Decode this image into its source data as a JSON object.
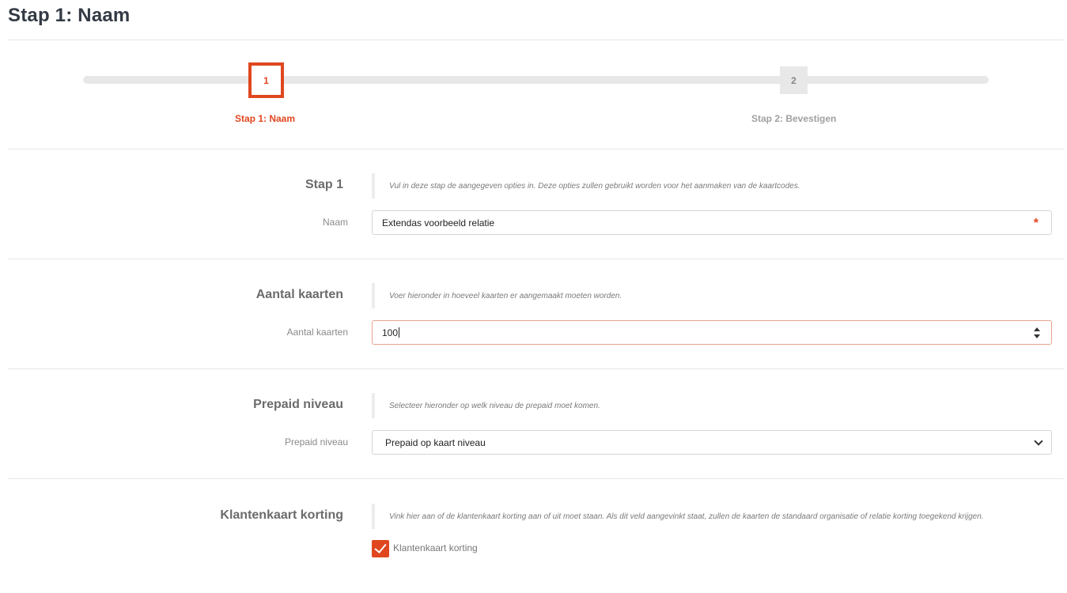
{
  "page": {
    "title": "Stap 1: Naam"
  },
  "stepper": {
    "steps": [
      {
        "number": "1",
        "label": "Stap 1: Naam",
        "active": true
      },
      {
        "number": "2",
        "label": "Stap 2: Bevestigen",
        "active": false
      }
    ]
  },
  "sections": {
    "step1": {
      "title": "Stap 1",
      "description": "Vul in deze stap de aangegeven opties in. Deze opties zullen gebruikt worden voor het aanmaken van de kaartcodes.",
      "field_label": "Naam",
      "value": "Extendas voorbeeld relatie",
      "required_mark": "*"
    },
    "cards": {
      "title": "Aantal kaarten",
      "description": "Voer hieronder in hoeveel kaarten er aangemaakt moeten worden.",
      "field_label": "Aantal kaarten",
      "value": "100"
    },
    "prepaid": {
      "title": "Prepaid niveau",
      "description": "Selecteer hieronder op welk niveau de prepaid moet komen.",
      "field_label": "Prepaid niveau",
      "selected": "Prepaid op kaart niveau"
    },
    "discount": {
      "title": "Klantenkaart korting",
      "description": "Vink hier aan of de klantenkaart korting aan of uit moet staan. Als dit veld aangevinkt staat, zullen de kaarten de standaard organisatie of relatie korting toegekend krijgen.",
      "checkbox_label": "Klantenkaart korting",
      "checked": true
    }
  },
  "colors": {
    "accent": "#e0471f",
    "track": "#e8e8e8"
  },
  "icons": {
    "required": "asterisk-icon",
    "stepper": "spinner-arrows-icon",
    "select": "chevron-down-icon",
    "check": "checkmark-icon"
  }
}
